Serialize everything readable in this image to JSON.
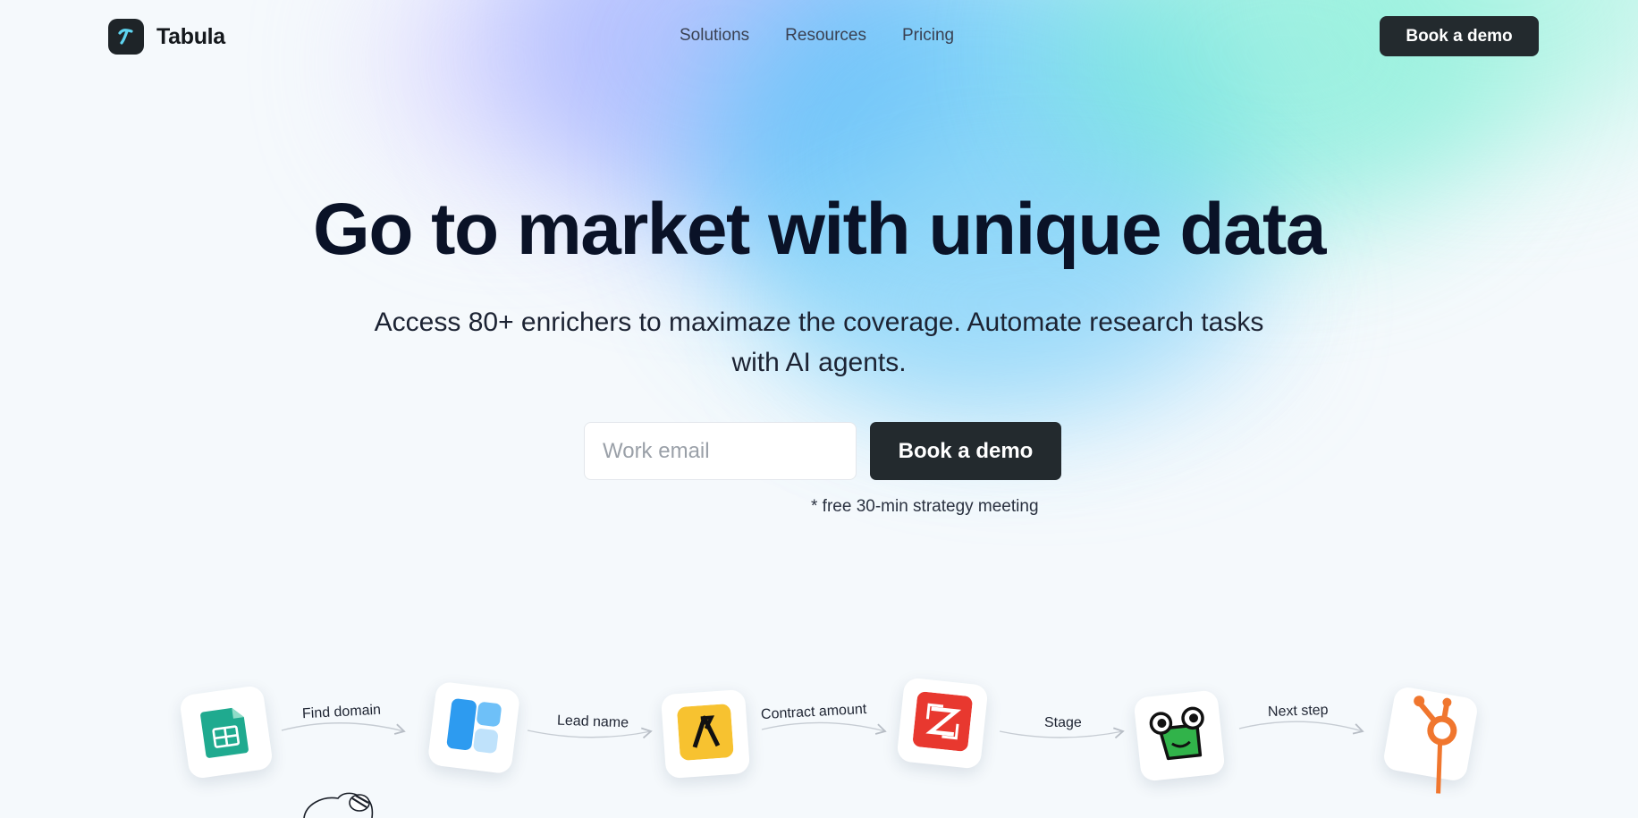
{
  "brand": {
    "name": "Tabula"
  },
  "nav": {
    "items": [
      "Solutions",
      "Resources",
      "Pricing"
    ]
  },
  "header": {
    "cta_label": "Book a demo"
  },
  "hero": {
    "title": "Go to market with unique data",
    "subtitle": "Access 80+ enrichers to maximaze the coverage. Automate research tasks with AI agents.",
    "email_placeholder": "Work email",
    "cta_label": "Book a demo",
    "note": "* free 30-min strategy meeting"
  },
  "workflow": {
    "steps": [
      "Find domain",
      "Lead name",
      "Contract amount",
      "Stage",
      "Next step"
    ],
    "tools": [
      "google-sheets-icon",
      "blue-app-icon",
      "apollo-icon",
      "zoominfo-icon",
      "frog-app-icon",
      "hubspot-icon"
    ]
  },
  "colors": {
    "dark_button": "#232a2e",
    "heading": "#0a1227",
    "sheets_green": "#1faa8f",
    "blue_app": "#2d9bf0",
    "apollo_yellow": "#f7c230",
    "zoominfo_red": "#e8382f",
    "frog_green": "#31b34a",
    "hubspot_orange": "#f0762e"
  }
}
